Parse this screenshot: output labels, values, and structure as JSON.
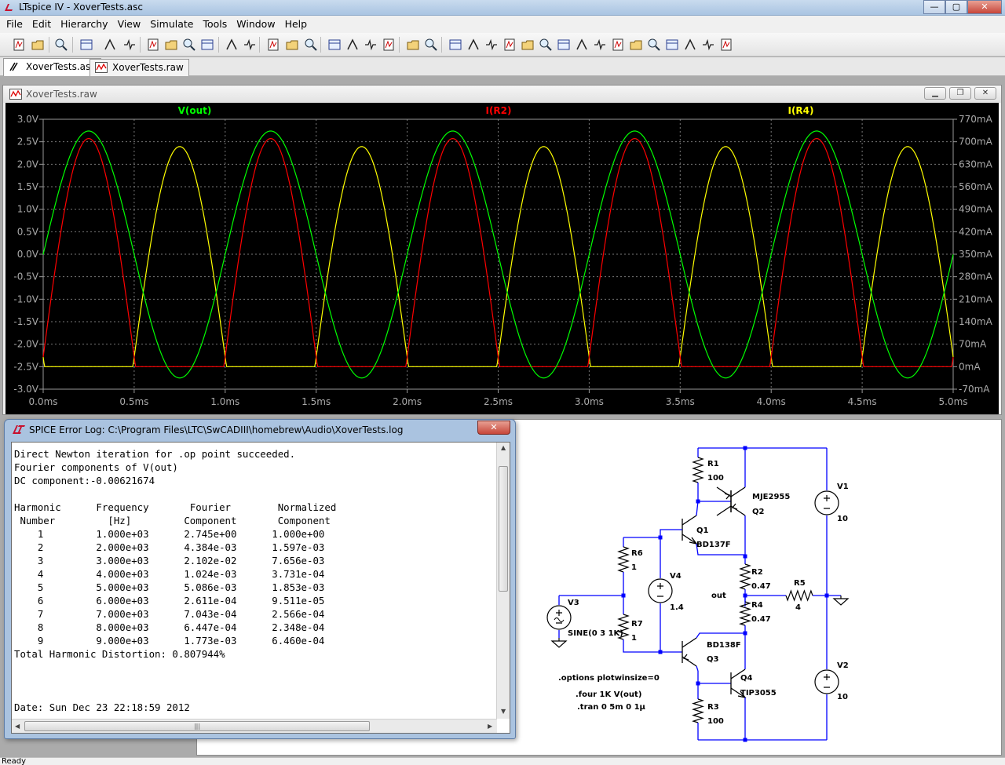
{
  "window": {
    "title": "LTspice IV - XoverTests.asc",
    "minimize": "—",
    "maximize": "▢",
    "close": "✕"
  },
  "menu": [
    "File",
    "Edit",
    "Hierarchy",
    "View",
    "Simulate",
    "Tools",
    "Window",
    "Help"
  ],
  "toolbar_icons": [
    "new-schematic",
    "open",
    "save",
    "control-panel",
    "run",
    "halt",
    "zoom-in",
    "zoom-out",
    "zoom-fit",
    "zoom-cancel",
    "autorange",
    "grid",
    "tile",
    "cascade",
    "close-window",
    "cut",
    "copy",
    "paste",
    "find",
    "print-preview",
    "print",
    "wire",
    "ground",
    "label-net",
    "resistor",
    "capacitor",
    "inductor",
    "diode",
    "component",
    "move",
    "drag",
    "undo",
    "redo",
    "rotate",
    "mirror",
    "text",
    "spice-directive"
  ],
  "tabs": [
    {
      "label": "XoverTests.asc",
      "icon": "schematic-icon"
    },
    {
      "label": "XoverTests.raw",
      "icon": "waveform-icon"
    }
  ],
  "plot_window": {
    "title": "XoverTests.raw",
    "chart_data": {
      "type": "line",
      "xlabel": "",
      "xlim": [
        0,
        5
      ],
      "x_ticks": [
        "0.0ms",
        "0.5ms",
        "1.0ms",
        "1.5ms",
        "2.0ms",
        "2.5ms",
        "3.0ms",
        "3.5ms",
        "4.0ms",
        "4.5ms",
        "5.0ms"
      ],
      "ylim_left": [
        -3.0,
        3.0
      ],
      "y_ticks_left": [
        "3.0V",
        "2.5V",
        "2.0V",
        "1.5V",
        "1.0V",
        "0.5V",
        "0.0V",
        "-0.5V",
        "-1.0V",
        "-1.5V",
        "-2.0V",
        "-2.5V",
        "-3.0V"
      ],
      "ylim_right": [
        -70,
        770
      ],
      "y_ticks_right": [
        "770mA",
        "700mA",
        "630mA",
        "560mA",
        "490mA",
        "420mA",
        "350mA",
        "280mA",
        "210mA",
        "140mA",
        "70mA",
        "0mA",
        "-70mA"
      ],
      "grid": true,
      "background": "#000000",
      "series": [
        {
          "name": "V(out)",
          "color": "#00ff00",
          "axis": "left",
          "frequency_khz": 1,
          "amplitude": 2.745,
          "offset": -0.006,
          "phase": "sine"
        },
        {
          "name": "I(R2)",
          "color": "#ff0000",
          "axis": "right",
          "frequency_khz": 1,
          "peak": 680,
          "floor": 0,
          "phase": "positive half"
        },
        {
          "name": "I(R4)",
          "color": "#ffff00",
          "axis": "right",
          "frequency_khz": 1,
          "peak": 655,
          "floor": 0,
          "phase": "negative half"
        }
      ]
    }
  },
  "schematic": {
    "labels": {
      "R1": "R1",
      "R1v": "100",
      "Q2m": "MJE2955",
      "Q2": "Q2",
      "Q1": "Q1",
      "Q1m": "BD137F",
      "R6": "R6",
      "R6v": "1",
      "V4": "V4",
      "V4v": "1.4",
      "V1": "V1",
      "V1v": "10",
      "R2": "R2",
      "R2v": "0.47",
      "R5": "R5",
      "R5v": "4",
      "out": "out",
      "R4": "R4",
      "R4v": "0.47",
      "V3": "V3",
      "V3v": "SINE(0 3 1K)",
      "R7": "R7",
      "R7v": "1",
      "Q3m": "BD138F",
      "Q3": "Q3",
      "Q4": "Q4",
      "Q4m": "TIP3055",
      "V2": "V2",
      "V2v": "10",
      "R3": "R3",
      "R3v": "100",
      "dir1": ".options plotwinsize=0",
      "dir2": ".four 1K V(out)",
      "dir3": ".tran 0 5m 0 1µ"
    }
  },
  "log_window": {
    "title": "SPICE Error Log: C:\\Program Files\\LTC\\SwCADIII\\homebrew\\Audio\\XoverTests.log",
    "close": "✕",
    "lines": [
      "Direct Newton iteration for .op point succeeded.",
      "Fourier components of V(out)",
      "DC component:-0.00621674",
      "",
      "Harmonic      Frequency       Fourier        Normalized",
      " Number         [Hz]         Component       Component",
      "    1         1.000e+03      2.745e+00      1.000e+00",
      "    2         2.000e+03      4.384e-03      1.597e-03",
      "    3         3.000e+03      2.102e-02      7.656e-03",
      "    4         4.000e+03      1.024e-03      3.731e-04",
      "    5         5.000e+03      5.086e-03      1.853e-03",
      "    6         6.000e+03      2.611e-04      9.511e-05",
      "    7         7.000e+03      7.043e-04      2.566e-04",
      "    8         8.000e+03      6.447e-04      2.348e-04",
      "    9         9.000e+03      1.773e-03      6.460e-04",
      "Total Harmonic Distortion: 0.807944%",
      "",
      "",
      "",
      "Date: Sun Dec 23 22:18:59 2012"
    ]
  },
  "status": {
    "text": "Ready"
  }
}
